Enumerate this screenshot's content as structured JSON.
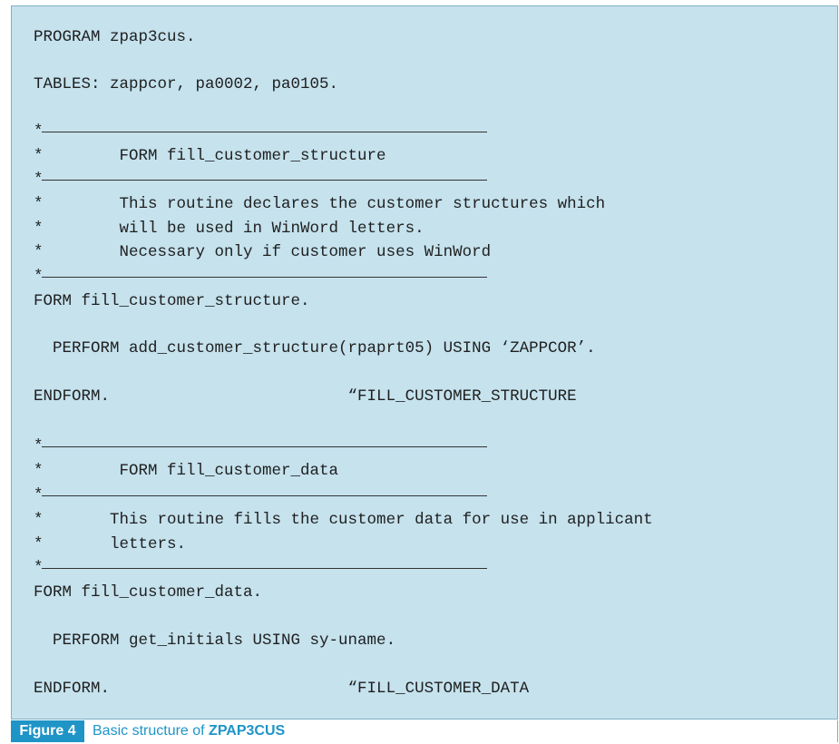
{
  "code_lines": [
    "PROGRAM zpap3cus.",
    "TABLES: zappcor, pa0002, pa0105.",
    "*",
    "*        FORM fill_customer_structure",
    "*",
    "*        This routine declares the customer structures which",
    "*        will be used in WinWord letters.",
    "*        Necessary only if customer uses WinWord",
    "*",
    "FORM fill_customer_structure.",
    "  PERFORM add_customer_structure(rpaprt05) USING ‘ZAPPCOR’.",
    "ENDFORM.                         “FILL_CUSTOMER_STRUCTURE",
    "*",
    "*        FORM fill_customer_data",
    "*",
    "*       This routine fills the customer data for use in applicant",
    "*       letters.",
    "*",
    "FORM fill_customer_data.",
    "  PERFORM get_initials USING sy-uname.",
    "ENDFORM.                         “FILL_CUSTOMER_DATA"
  ],
  "figure": {
    "label": "Figure 4",
    "caption": "Basic structure of ",
    "caption_code": "ZPAP3CUS"
  },
  "colors": {
    "code_background": "#c5e2ed",
    "accent": "#1f94c7"
  }
}
